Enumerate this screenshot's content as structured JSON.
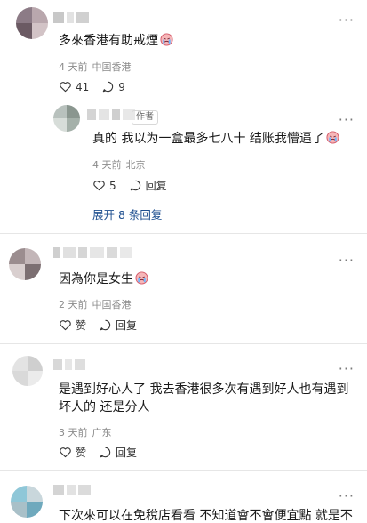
{
  "comments": [
    {
      "text": "多來香港有助戒煙",
      "time": "4 天前",
      "location": "中国香港",
      "likes": "41",
      "replies": "9"
    },
    {
      "author_tag": "作者",
      "text": "真的 我以为一盒最多七八十 结账我懵逼了",
      "time": "4 天前",
      "location": "北京",
      "likes": "5",
      "reply_label": "回复",
      "expand_label": "展开 8 条回复"
    },
    {
      "text": "因為你是女生",
      "time": "2 天前",
      "location": "中国香港",
      "like_label": "赞",
      "reply_label": "回复"
    },
    {
      "text_line1": "是遇到好心人了 我去香港很多次有遇到好人也有遇到",
      "text_line2": "坏人的 还是分人",
      "time": "3 天前",
      "location": "广东",
      "like_label": "赞",
      "reply_label": "回复"
    },
    {
      "text": "下次來可以在免稅店看看 不知道會不會便宜點 就是不"
    }
  ],
  "more_label": "···",
  "icons": {
    "like": "heart-icon",
    "reply": "speech-bubble-icon",
    "emoji": "crying-face-emoji-icon"
  },
  "colors": {
    "link": "#1d4e8f",
    "meta": "#8a8a8a"
  }
}
